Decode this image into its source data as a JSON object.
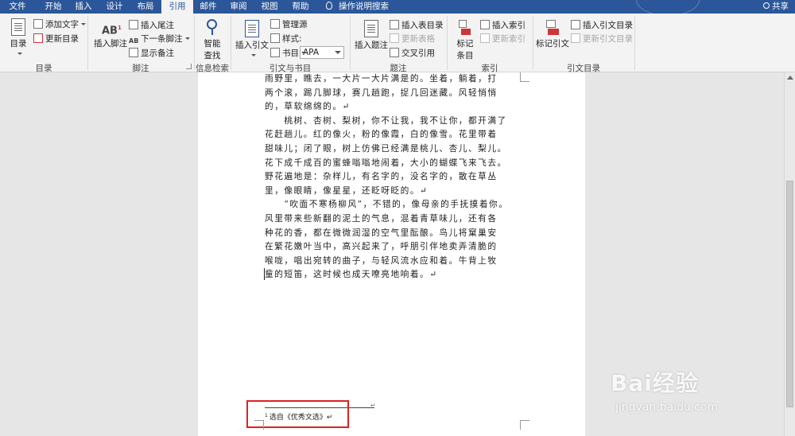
{
  "tabs": [
    "文件",
    "开始",
    "插入",
    "设计",
    "布局",
    "引用",
    "邮件",
    "审阅",
    "视图",
    "帮助"
  ],
  "active_tab": "引用",
  "tell_me": "操作说明搜索",
  "share": "共享",
  "ribbon": {
    "toc": {
      "toc_label": "目录",
      "add_text": "添加文字",
      "update_toc": "更新目录",
      "group": "目录"
    },
    "footnotes": {
      "insert_footnote": "插入脚注",
      "insert_endnote": "插入尾注",
      "next_footnote": "下一条脚注",
      "show_notes": "显示备注",
      "group": "脚注"
    },
    "research": {
      "smart_lookup_1": "智能",
      "smart_lookup_2": "查找",
      "group": "信息检索"
    },
    "citations": {
      "insert_citation": "插入引文",
      "manage_sources": "管理源",
      "style_label": "样式:",
      "style_value": "APA",
      "bibliography": "书目",
      "group": "引文与书目"
    },
    "captions": {
      "insert_caption": "插入题注",
      "insert_table_of_figures": "插入表目录",
      "update_table": "更新表格",
      "cross_reference": "交叉引用",
      "group": "题注"
    },
    "index": {
      "mark_entry_1": "标记",
      "mark_entry_2": "条目",
      "insert_index": "插入索引",
      "update_index": "更新索引",
      "group": "索引"
    },
    "toa": {
      "mark_citation": "标记引文",
      "insert_toa": "插入引文目录",
      "update_toa": "更新引文目录",
      "group": "引文目录"
    }
  },
  "document": {
    "lines": [
      "雨野里，瞧去，一大片一大片满是的。坐着，躺着，打",
      "两个滚，踢几脚球，赛几趟跑，捉几回迷藏。风轻悄悄",
      "的，草软绵绵的。↵",
      "　　桃树、杏树、梨树，你不让我，我不让你，都开满了",
      "花赶趟儿。红的像火，粉的像霞，白的像雪。花里带着",
      "甜味儿；闭了眼，树上仿佛已经满是桃儿、杏儿、梨儿。",
      "花下成千成百的蜜蜂嗡嗡地闹着，大小的蝴蝶飞来飞去。",
      "野花遍地是：杂样儿，有名字的，没名字的，散在草丛",
      "里，像眼睛，像星星，还眨呀眨的。↵",
      "　　“吹面不寒杨柳风”，不错的，像母亲的手抚摸着你。",
      "风里带来些新翻的泥土的气息，混着青草味儿，还有各",
      "种花的香，都在微微润湿的空气里酝酿。鸟儿将窠巢安",
      "在繁花嫩叶当中，高兴起来了，呼朋引伴地卖弄清脆的",
      "喉咙，唱出宛转的曲子，与轻风流水应和着。牛背上牧",
      "童的短笛，这时候也成天嘹亮地响着。↵"
    ],
    "empty_para_mark": "↵",
    "footnote_number": "1",
    "footnote_text": "选自《优秀文选》↵"
  },
  "watermark": {
    "brand": "Bai经验",
    "site": "jingyan.baidu.com"
  },
  "colors": {
    "accent": "#2b579a",
    "highlight_box": "#e02020"
  }
}
